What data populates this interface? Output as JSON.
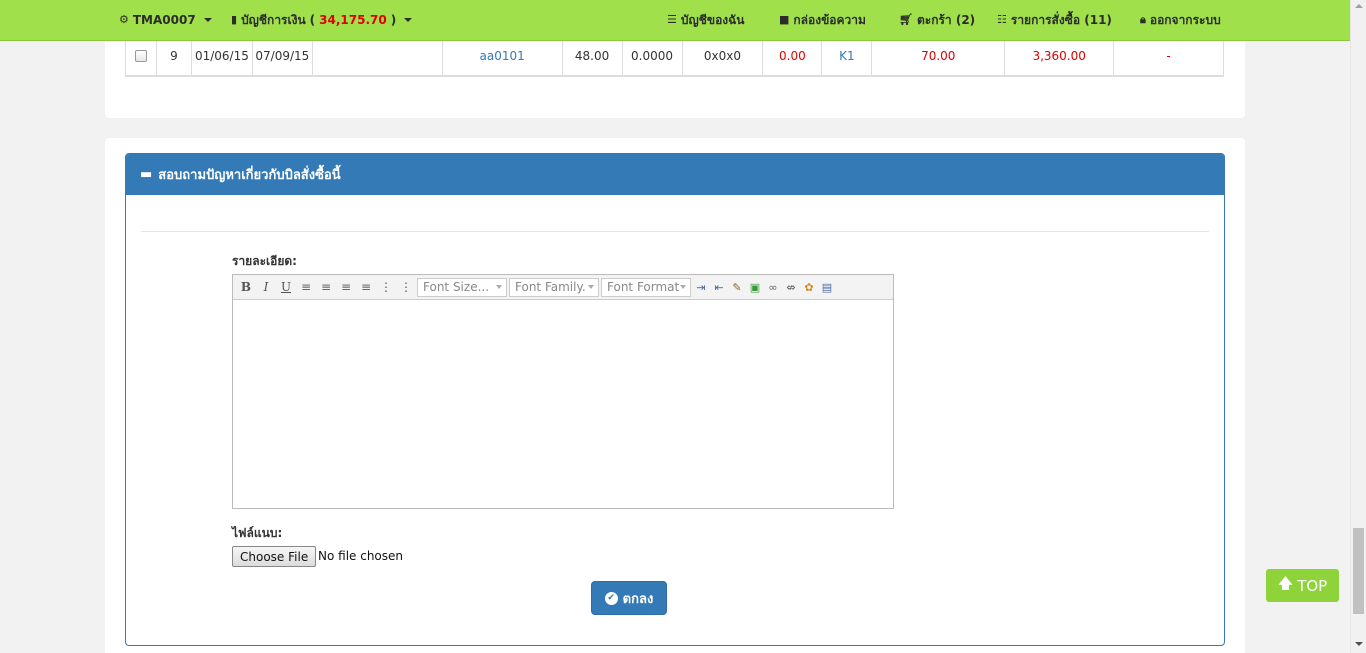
{
  "nav": {
    "account": "TMA0007",
    "finance_label": "บัญชีการเงิน",
    "finance_amount": "34,175.70",
    "my_account": "บัญชีของฉัน",
    "messages": "กล่องข้อความ",
    "cart": "ตะกร้า (2)",
    "orders": "รายการสั่งซื้อ (11)",
    "logout": "ออกจากระบบ"
  },
  "order_row": {
    "no": "9",
    "date1": "01/06/15",
    "date2": "07/09/15",
    "blank": "",
    "code": "aa0101",
    "amount": "48.00",
    "rate": "0.0000",
    "dimensions": "0x0x0",
    "price1": "0.00",
    "type": "K1",
    "price2": "70.00",
    "total": "3,360.00",
    "status": "-"
  },
  "inquiry": {
    "title": "สอบถามปัญหาเกี่ยวกับบิลสั่งซื้อนี้",
    "detail_label": "รายละเอียด:",
    "attach_label": "ไฟล์แนบ:",
    "choose_file": "Choose File",
    "no_file": "No file chosen",
    "submit": "ตกลง"
  },
  "editor": {
    "font_size": "Font Size...",
    "font_family": "Font Family.",
    "font_format": "Font Format"
  },
  "top_button": "TOP",
  "colors": {
    "navbar": "#a0e04a",
    "primary": "#337ab7",
    "amount_red": "#e00000",
    "top_button": "#8fd33a"
  }
}
